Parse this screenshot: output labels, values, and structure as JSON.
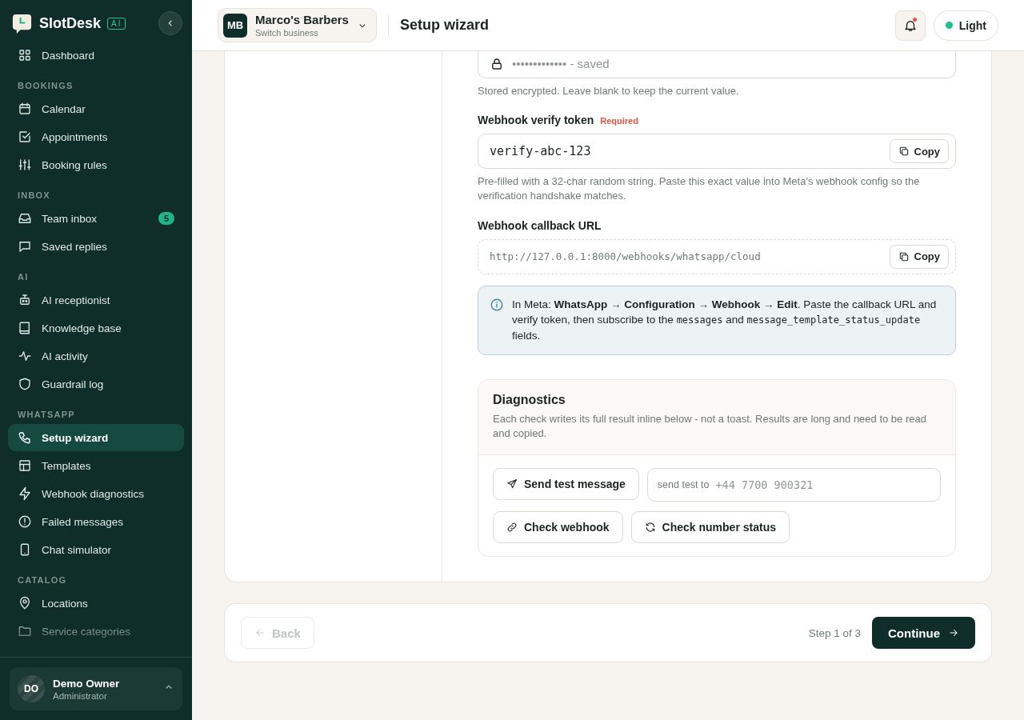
{
  "sidebar": {
    "brand": "SlotDesk",
    "brand_badge": "AI",
    "sections": [
      {
        "items": [
          {
            "label": "Dashboard",
            "selected": false
          }
        ]
      },
      {
        "title": "BOOKINGS",
        "items": [
          {
            "label": "Calendar",
            "selected": false
          },
          {
            "label": "Appointments",
            "selected": false
          },
          {
            "label": "Booking rules",
            "selected": false
          }
        ]
      },
      {
        "title": "INBOX",
        "items": [
          {
            "label": "Team inbox",
            "selected": false,
            "badge": "5"
          },
          {
            "label": "Saved replies",
            "selected": false
          }
        ]
      },
      {
        "title": "AI",
        "items": [
          {
            "label": "AI receptionist",
            "selected": false
          },
          {
            "label": "Knowledge base",
            "selected": false
          },
          {
            "label": "AI activity",
            "selected": false
          },
          {
            "label": "Guardrail log",
            "selected": false
          }
        ]
      },
      {
        "title": "WHATSAPP",
        "items": [
          {
            "label": "Setup wizard",
            "selected": true
          },
          {
            "label": "Templates",
            "selected": false
          },
          {
            "label": "Webhook diagnostics",
            "selected": false
          },
          {
            "label": "Failed messages",
            "selected": false
          },
          {
            "label": "Chat simulator",
            "selected": false
          }
        ]
      },
      {
        "title": "CATALOG",
        "items": [
          {
            "label": "Locations",
            "selected": false
          },
          {
            "label": "Service categories",
            "selected": false
          }
        ]
      }
    ],
    "user": {
      "initials": "DO",
      "name": "Demo Owner",
      "role": "Administrator"
    }
  },
  "header": {
    "business": {
      "initials": "MB",
      "name": "Marco's Barbers",
      "subtitle": "Switch business"
    },
    "title": "Setup wizard",
    "notification_dot": true,
    "theme_button": "Light"
  },
  "form": {
    "secret_field": {
      "placeholder": "••••••••••••• - saved",
      "help": "Stored encrypted. Leave blank to keep the current value."
    },
    "verify_token": {
      "label": "Webhook verify token",
      "required": "Required",
      "value": "verify-abc-123",
      "copy": "Copy",
      "help": "Pre-filled with a 32-char random string. Paste this exact value into Meta's webhook config so the verification handshake matches."
    },
    "callback_url": {
      "label": "Webhook callback URL",
      "value": "http://127.0.0.1:8000/webhooks/whatsapp/cloud",
      "copy": "Copy"
    },
    "info": [
      {
        "kind": "text",
        "text": "In Meta: **WhatsApp → Configuration → Webhook → Edit**. Paste the callback URL and verify token, then subscribe to the "
      },
      {
        "kind": "code",
        "text": "messages"
      },
      {
        "kind": "text",
        "text": " and "
      },
      {
        "kind": "code",
        "text": "message_template_status_update"
      },
      {
        "kind": "text",
        "text": " fields."
      }
    ],
    "diagnostics": {
      "title": "Diagnostics",
      "description": "Each check writes its full result inline below - not a toast. Results are long and need to be read and copied.",
      "send_button": "Send test message",
      "phone_prefix": "send test to",
      "phone_placeholder": "+44 7700 900321",
      "check_webhook": "Check webhook",
      "check_number": "Check number status"
    }
  },
  "footer": {
    "back": "Back",
    "back_disabled": true,
    "step": "Step 1 of 3",
    "continue": "Continue"
  }
}
